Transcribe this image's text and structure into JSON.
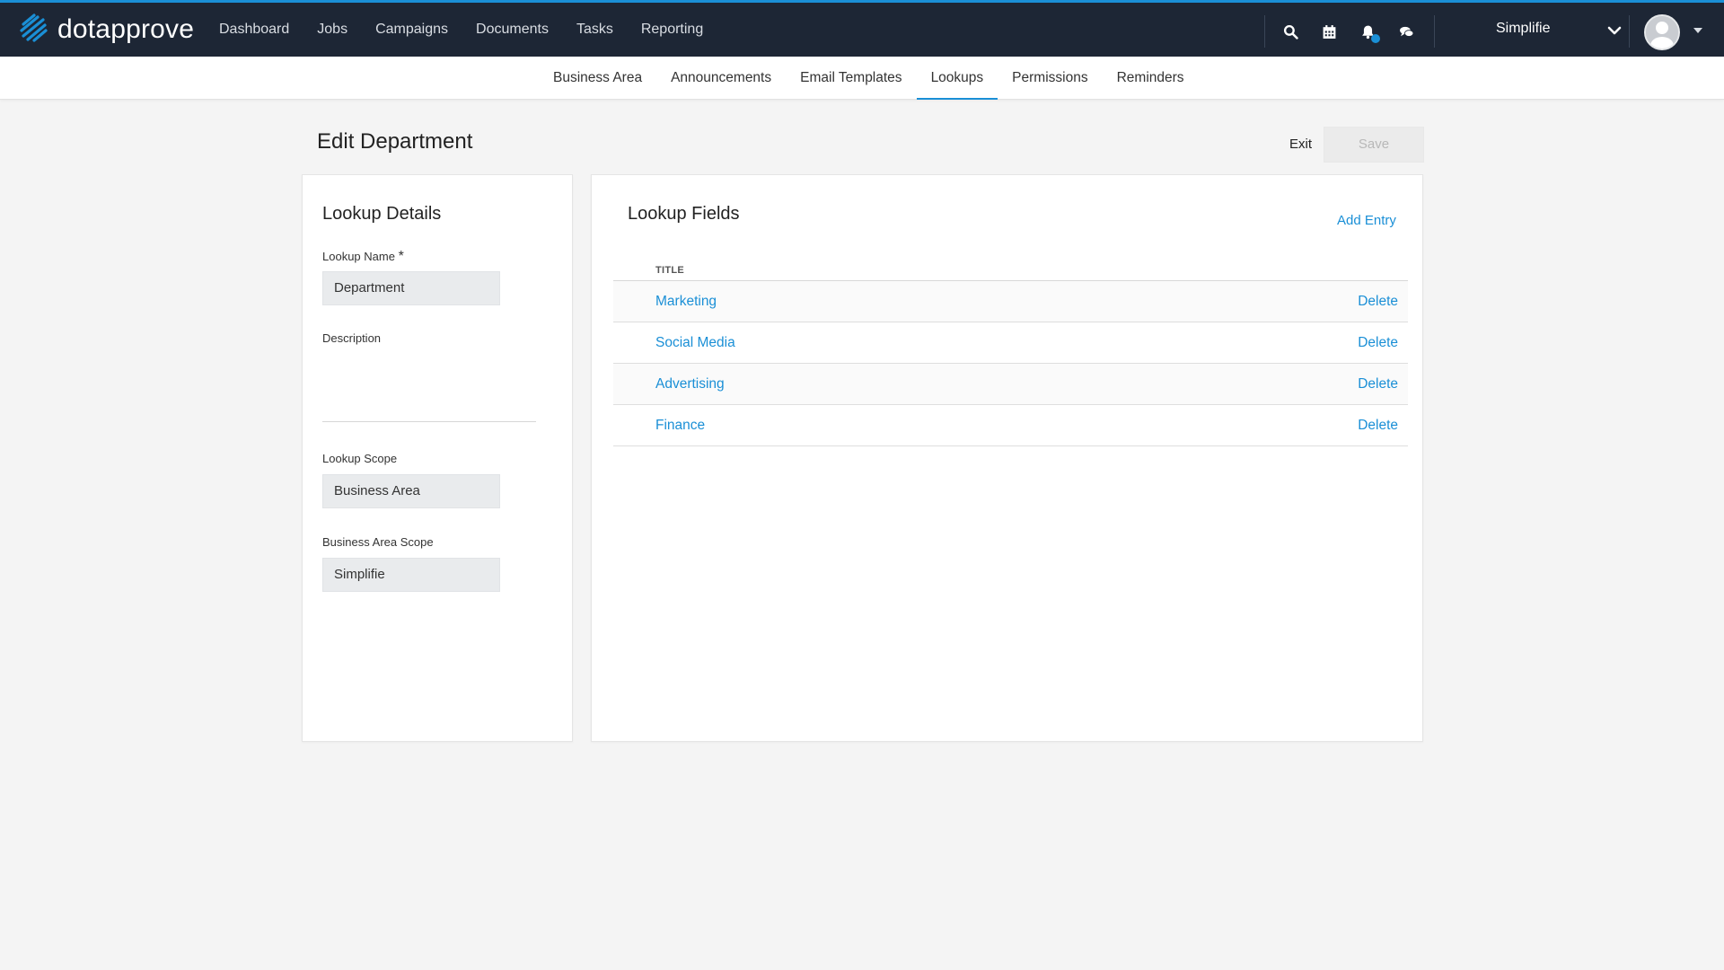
{
  "brand": {
    "name": "dotapprove",
    "accent": "#1a8fd6",
    "nav_bg": "#1d2635"
  },
  "main_nav": {
    "items": [
      {
        "label": "Dashboard"
      },
      {
        "label": "Jobs"
      },
      {
        "label": "Campaigns"
      },
      {
        "label": "Documents"
      },
      {
        "label": "Tasks"
      },
      {
        "label": "Reporting"
      }
    ]
  },
  "toolbar": {
    "icons": [
      "search-icon",
      "calendar-icon",
      "bell-icon",
      "chat-icon"
    ],
    "org_name": "Simplifie"
  },
  "sub_nav": {
    "items": [
      {
        "label": "Business Area"
      },
      {
        "label": "Announcements"
      },
      {
        "label": "Email Templates"
      },
      {
        "label": "Lookups",
        "active": true
      },
      {
        "label": "Permissions"
      },
      {
        "label": "Reminders"
      }
    ]
  },
  "page": {
    "title": "Edit Department",
    "exit_label": "Exit",
    "save_label": "Save"
  },
  "details": {
    "title": "Lookup Details",
    "name_label": "Lookup Name",
    "required_mark": "*",
    "name_value": "Department",
    "description_label": "Description",
    "description_value": "",
    "scope_label": "Lookup Scope",
    "scope_value": "Business Area",
    "ba_scope_label": "Business Area Scope",
    "ba_scope_value": "Simplifie"
  },
  "fields": {
    "title": "Lookup Fields",
    "add_label": "Add Entry",
    "column_title": "TITLE",
    "delete_label": "Delete",
    "rows": [
      {
        "title": "Marketing"
      },
      {
        "title": "Social Media"
      },
      {
        "title": "Advertising"
      },
      {
        "title": "Finance"
      }
    ]
  }
}
